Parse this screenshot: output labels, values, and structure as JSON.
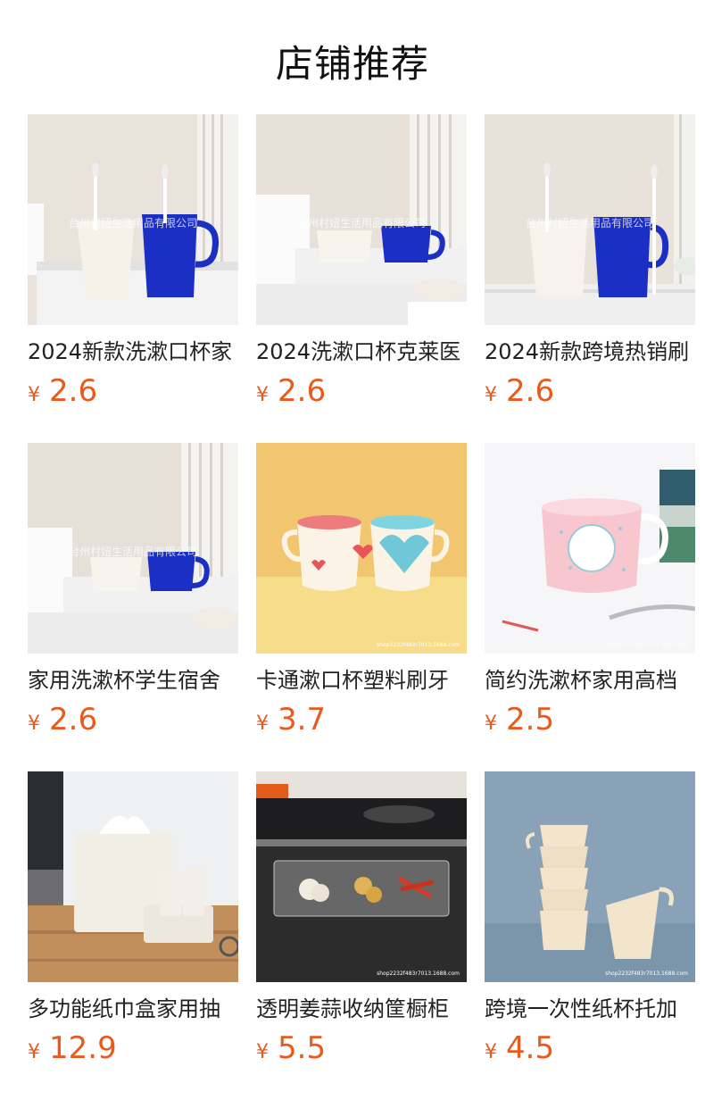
{
  "header": {
    "title": "店铺推荐"
  },
  "products": [
    {
      "title": "2024新款洗漱口杯家",
      "currency": "¥",
      "price": "2.6",
      "watermark": "台州村妞生活用品有限公司"
    },
    {
      "title": "2024洗漱口杯克莱医",
      "currency": "¥",
      "price": "2.6",
      "watermark": "台州村妞生活用品有限公司"
    },
    {
      "title": "2024新款跨境热销刷",
      "currency": "¥",
      "price": "2.6",
      "watermark": "台州村妞生活用品有限公司"
    },
    {
      "title": "家用洗漱杯学生宿舍",
      "currency": "¥",
      "price": "2.6",
      "watermark": "台州村妞生活用品有限公司"
    },
    {
      "title": "卡通漱口杯塑料刷牙",
      "currency": "¥",
      "price": "3.7",
      "watermark": "shop2232f483r7013.1688.com"
    },
    {
      "title": "简约洗漱杯家用高档",
      "currency": "¥",
      "price": "2.5",
      "watermark": "shop2232f483r7013.1688.com"
    },
    {
      "title": "多功能纸巾盒家用抽",
      "currency": "¥",
      "price": "12.9",
      "watermark": ""
    },
    {
      "title": "透明姜蒜收纳筐橱柜",
      "currency": "¥",
      "price": "5.5",
      "watermark": "shop2232f483r7013.1688.com"
    },
    {
      "title": "跨境一次性纸杯托加",
      "currency": "¥",
      "price": "4.5",
      "watermark": "shop2232f483r7013.1688.com"
    }
  ],
  "colors": {
    "price": "#e85a1e",
    "title": "#222222"
  }
}
